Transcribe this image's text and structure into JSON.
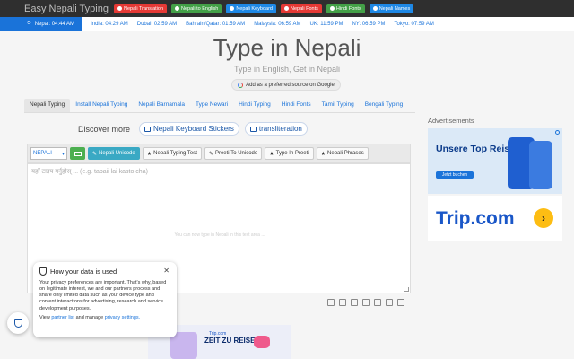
{
  "header": {
    "logo": "Easy Nepali Typing",
    "nav": [
      {
        "label": "Nepali Translation",
        "color": "#e53935"
      },
      {
        "label": "Nepali to English",
        "color": "#43a047"
      },
      {
        "label": "Nepali Keyboard",
        "color": "#1e88e5"
      },
      {
        "label": "Nepali Fonts",
        "color": "#e53935"
      },
      {
        "label": "Hindi Fonts",
        "color": "#43a047"
      },
      {
        "label": "Nepali Names",
        "color": "#1e88e5"
      }
    ]
  },
  "timebar": {
    "active": "Nepal: 04:44 AM",
    "zones": [
      "India: 04:29 AM",
      "Dubai: 02:59 AM",
      "Bahrain/Qatar: 01:59 AM",
      "Malaysia: 06:59 AM",
      "UK: 11:59 PM",
      "NY: 06:59 PM",
      "Tokyo: 07:59 AM"
    ]
  },
  "hero": {
    "title": "Type in Nepali",
    "subtitle": "Type in English, Get in Nepali",
    "google_source": "Add as a preferred source on Google"
  },
  "tabs": [
    "Nepali Typing",
    "Install Nepali Typing",
    "Nepali Barnamala",
    "Type Newari",
    "Hindi Typing",
    "Hindi Fonts",
    "Tamil Typing",
    "Bengali Typing"
  ],
  "discover": {
    "label": "Discover more",
    "links": [
      "Nepali Keyboard Stickers",
      "transliteration"
    ]
  },
  "toolbar": {
    "language": "NEPALI",
    "buttons": [
      "Nepali Unicode",
      "Nepali Typing Test",
      "Preeti To Unicode",
      "Type In Preeti",
      "Nepali Phrases"
    ]
  },
  "editor": {
    "placeholder": "यहाँ टाइप गर्नुहोस् ... (e.g. tapaii lai kasto cha)",
    "hint": "You can now type in Nepali in this text area ..."
  },
  "ads": {
    "label": "Advertisements",
    "ad1_title": "Unsere Top Reisedeals",
    "ad1_button": "Jetzt buchen",
    "ad2_logo": "Trip.com",
    "ad3_logo": "Trip.com",
    "ad3_title": "ZEIT ZU REISEN!"
  },
  "privacy": {
    "title": "How your data is used",
    "body": "Your privacy preferences are important. That's why, based on legitimate interest, we and our partners process and share only limited data such as your device type and content interactions for advertising, research and service development purposes.",
    "foot_prefix": "View",
    "partner_link": "partner list",
    "foot_mid": "and manage",
    "settings_link": "privacy settings."
  }
}
